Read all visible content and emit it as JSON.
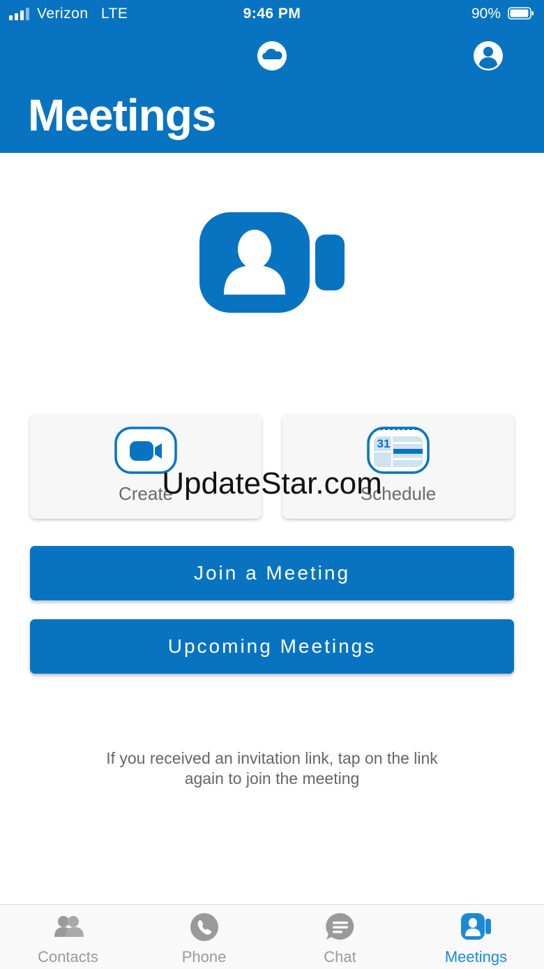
{
  "status_bar": {
    "carrier": "Verizon",
    "network": "LTE",
    "time": "9:46 PM",
    "battery_percent": "90%",
    "signal_bars": 4,
    "battery_level": 0.9
  },
  "header": {
    "title": "Meetings",
    "icons": [
      "cloud-icon",
      "profile-icon"
    ]
  },
  "actions": {
    "create_label": "Create",
    "schedule_label": "Schedule",
    "calendar_day": "31",
    "join_label": "Join a Meeting",
    "upcoming_label": "Upcoming Meetings"
  },
  "hint_line1": "If you received an invitation link, tap on the link",
  "hint_line2": "again to join the meeting",
  "watermark": "UpdateStar.com",
  "tabbar": {
    "tabs": [
      {
        "label": "Contacts",
        "icon": "contacts-icon"
      },
      {
        "label": "Phone",
        "icon": "phone-icon"
      },
      {
        "label": "Chat",
        "icon": "chat-icon"
      },
      {
        "label": "Meetings",
        "icon": "meetings-icon"
      }
    ],
    "active": "Meetings"
  },
  "colors": {
    "brand": "#0874c1",
    "tab_active": "#1a8ad8",
    "tab_inactive": "#9a9a9a",
    "text_secondary": "#666666"
  }
}
